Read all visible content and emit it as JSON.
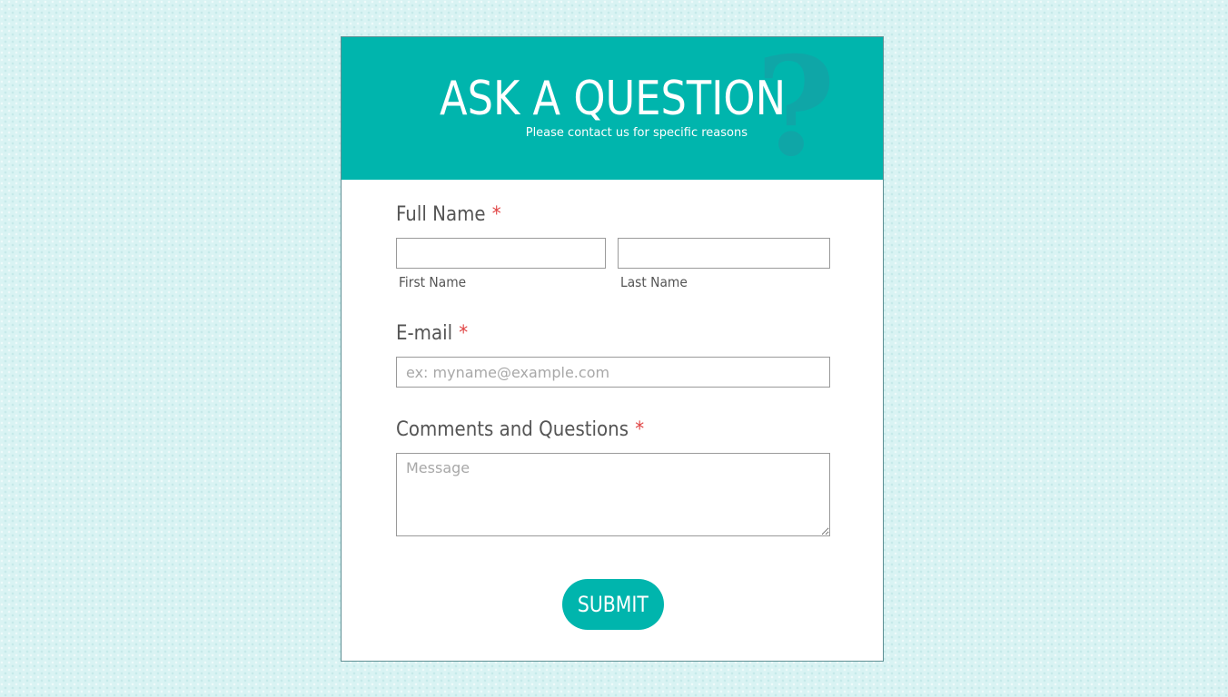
{
  "header": {
    "title": "ASK A QUESTION",
    "subtitle": "Please contact us for specific reasons",
    "icon": "question-mark-icon",
    "icon_glyph": "?"
  },
  "full_name": {
    "label": "Full Name",
    "required": "*",
    "first_name": {
      "value": "",
      "sublabel": "First Name"
    },
    "last_name": {
      "value": "",
      "sublabel": "Last Name"
    }
  },
  "email": {
    "label": "E-mail",
    "required": "*",
    "value": "",
    "placeholder": "ex: myname@example.com"
  },
  "comments": {
    "label": "Comments and Questions",
    "required": "*",
    "value": "",
    "placeholder": "Message"
  },
  "submit": {
    "label": "SUBMIT"
  },
  "colors": {
    "accent": "#00b5ad",
    "required": "#e04444",
    "background": "#d9f3f3"
  }
}
